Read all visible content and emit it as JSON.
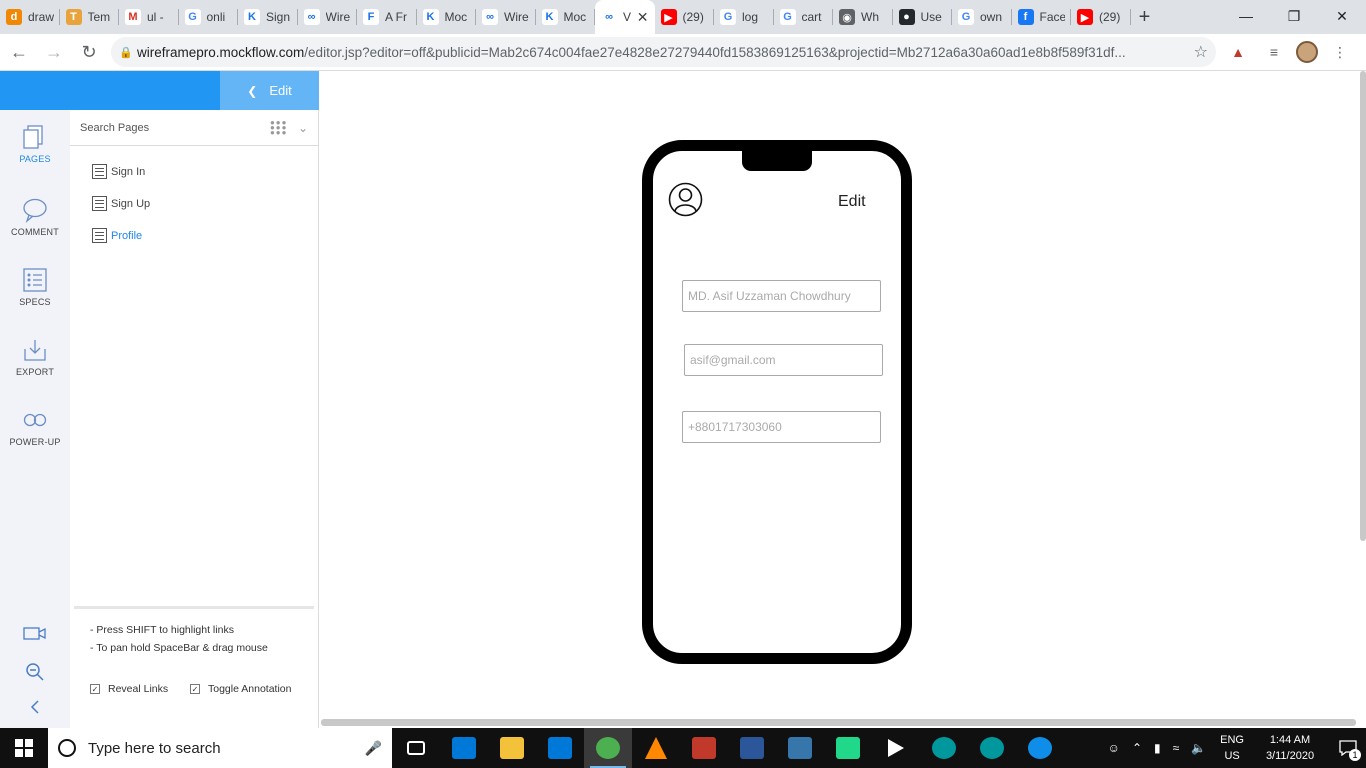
{
  "browser": {
    "tabs": [
      {
        "title": "draw",
        "icon": "drawio-icon",
        "color": "#f08705",
        "glyph": "d"
      },
      {
        "title": "Tem",
        "icon": "template-icon",
        "color": "#e8a33d",
        "glyph": "T"
      },
      {
        "title": "ul -",
        "icon": "gmail-icon",
        "color": "#ffffff",
        "glyph": "M"
      },
      {
        "title": "onli",
        "icon": "google-icon",
        "color": "#ffffff",
        "glyph": "G"
      },
      {
        "title": "Sign",
        "icon": "mockflow-icon",
        "color": "#ffffff",
        "glyph": "K"
      },
      {
        "title": "Wire",
        "icon": "wireframepro-icon",
        "color": "#ffffff",
        "glyph": "∞"
      },
      {
        "title": "A Fr",
        "icon": "figma-icon",
        "color": "#ffffff",
        "glyph": "F"
      },
      {
        "title": "Moc",
        "icon": "mockflow-icon",
        "color": "#ffffff",
        "glyph": "K"
      },
      {
        "title": "Wire",
        "icon": "wireframepro-icon",
        "color": "#ffffff",
        "glyph": "∞"
      },
      {
        "title": "Moc",
        "icon": "mockflow-icon",
        "color": "#ffffff",
        "glyph": "K"
      },
      {
        "title": "V",
        "icon": "wireframepro-icon",
        "color": "#ffffff",
        "glyph": "∞",
        "active": true
      },
      {
        "title": "(29)",
        "icon": "youtube-icon",
        "color": "#ff0000",
        "glyph": "▶"
      },
      {
        "title": "log",
        "icon": "google-icon",
        "color": "#ffffff",
        "glyph": "G"
      },
      {
        "title": "cart",
        "icon": "google-icon",
        "color": "#ffffff",
        "glyph": "G"
      },
      {
        "title": "Wh",
        "icon": "globe-icon",
        "color": "#5f6368",
        "glyph": "◉"
      },
      {
        "title": "Use",
        "icon": "github-icon",
        "color": "#24292e",
        "glyph": "●"
      },
      {
        "title": "own",
        "icon": "google-icon",
        "color": "#ffffff",
        "glyph": "G"
      },
      {
        "title": "Face",
        "icon": "facebook-icon",
        "color": "#1877f2",
        "glyph": "f"
      },
      {
        "title": "(29)",
        "icon": "youtube-icon",
        "color": "#ff0000",
        "glyph": "▶"
      }
    ],
    "url_domain": "wireframepro.mockflow.com",
    "url_path": "/editor.jsp?editor=off&publicid=Mab2c674c004fae27e4828e27279440fd1583869125163&projectid=Mb2712a6a30a60ad1e8b8f589f31df..."
  },
  "app": {
    "edit_label": "Edit",
    "rail": [
      {
        "label": "PAGES",
        "icon": "pages-icon"
      },
      {
        "label": "COMMENT",
        "icon": "comment-icon"
      },
      {
        "label": "SPECS",
        "icon": "specs-icon"
      },
      {
        "label": "EXPORT",
        "icon": "export-icon"
      },
      {
        "label": "POWER-UP",
        "icon": "power-up-icon"
      }
    ],
    "search_placeholder": "Search Pages",
    "pages": [
      "Sign In",
      "Sign Up",
      "Profile"
    ],
    "current_page": "Profile",
    "tips": [
      "- Press SHIFT to highlight links",
      "- To pan hold SpaceBar & drag mouse"
    ],
    "reveal_links": "Reveal Links",
    "toggle_annotation": "Toggle Annotation"
  },
  "wireframe": {
    "edit_text": "Edit",
    "name_placeholder": "MD. Asif Uzzaman Chowdhury",
    "email_placeholder": "asif@gmail.com",
    "phone_placeholder": "+8801717303060"
  },
  "taskbar": {
    "search_text": "Type here to search",
    "lang_top": "ENG",
    "lang_bottom": "US",
    "time": "1:44 AM",
    "date": "3/11/2020",
    "notifications": "1",
    "apps": [
      {
        "name": "task-view-icon",
        "color": "#101010"
      },
      {
        "name": "store-icon",
        "color": "#0078d7"
      },
      {
        "name": "file-explorer-icon",
        "color": "#f3c13a"
      },
      {
        "name": "mail-icon",
        "color": "#0078d7"
      },
      {
        "name": "chrome-icon",
        "color": "#4caf50"
      },
      {
        "name": "vlc-icon",
        "color": "#ff8800"
      },
      {
        "name": "acrobat-icon",
        "color": "#c0392b"
      },
      {
        "name": "word-icon",
        "color": "#2b579a"
      },
      {
        "name": "python-icon",
        "color": "#3776ab"
      },
      {
        "name": "pycharm-icon",
        "color": "#21d789"
      },
      {
        "name": "media-player-icon",
        "color": "#ffffff"
      },
      {
        "name": "arduino-icon",
        "color": "#00979d"
      },
      {
        "name": "arduino-icon",
        "color": "#00979d"
      },
      {
        "name": "teamviewer-icon",
        "color": "#0e8ee9"
      }
    ]
  }
}
